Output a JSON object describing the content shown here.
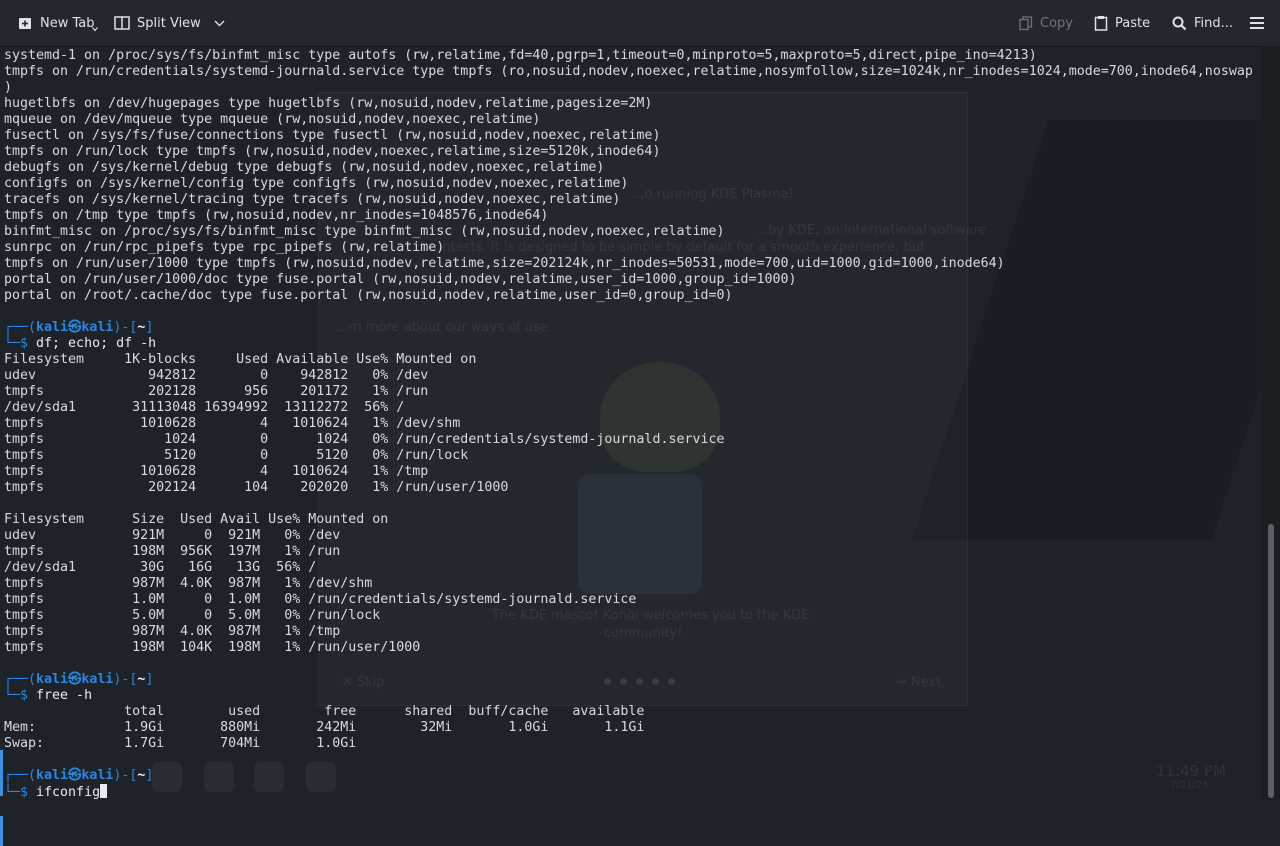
{
  "toolbar": {
    "new_tab": "New Tab",
    "split_view": "Split View",
    "copy": "Copy",
    "paste": "Paste",
    "find": "Find..."
  },
  "background_text": {
    "line1": "...o running KDE Plasma!",
    "line2": "...by KDE, an international software",
    "line3": "...ntests. It is designed to be simple by default for a smooth experience, but",
    "line4": "...rn more about our ways of use",
    "line5": "The KDE mascot Konqi welcomes you to the KDE",
    "line6": "community!",
    "skip": "✕ Skip",
    "next": "→ Next",
    "clock_time": "11:49 PM",
    "clock_date": "7/21/25"
  },
  "terminal": {
    "mount_lines": [
      "systemd-1 on /proc/sys/fs/binfmt_misc type autofs (rw,relatime,fd=40,pgrp=1,timeout=0,minproto=5,maxproto=5,direct,pipe_ino=4213)",
      "tmpfs on /run/credentials/systemd-journald.service type tmpfs (ro,nosuid,nodev,noexec,relatime,nosymfollow,size=1024k,nr_inodes=1024,mode=700,inode64,noswap",
      ")",
      "hugetlbfs on /dev/hugepages type hugetlbfs (rw,nosuid,nodev,relatime,pagesize=2M)",
      "mqueue on /dev/mqueue type mqueue (rw,nosuid,nodev,noexec,relatime)",
      "fusectl on /sys/fs/fuse/connections type fusectl (rw,nosuid,nodev,noexec,relatime)",
      "tmpfs on /run/lock type tmpfs (rw,nosuid,nodev,noexec,relatime,size=5120k,inode64)",
      "debugfs on /sys/kernel/debug type debugfs (rw,nosuid,nodev,noexec,relatime)",
      "configfs on /sys/kernel/config type configfs (rw,nosuid,nodev,noexec,relatime)",
      "tracefs on /sys/kernel/tracing type tracefs (rw,nosuid,nodev,noexec,relatime)",
      "tmpfs on /tmp type tmpfs (rw,nosuid,nodev,nr_inodes=1048576,inode64)",
      "binfmt_misc on /proc/sys/fs/binfmt_misc type binfmt_misc (rw,nosuid,nodev,noexec,relatime)",
      "sunrpc on /run/rpc_pipefs type rpc_pipefs (rw,relatime)",
      "tmpfs on /run/user/1000 type tmpfs (rw,nosuid,nodev,relatime,size=202124k,nr_inodes=50531,mode=700,uid=1000,gid=1000,inode64)",
      "portal on /run/user/1000/doc type fuse.portal (rw,nosuid,nodev,relatime,user_id=1000,group_id=1000)",
      "portal on /root/.cache/doc type fuse.portal (rw,nosuid,nodev,relatime,user_id=0,group_id=0)"
    ],
    "prompt_user": "kali",
    "prompt_at": "㉿",
    "prompt_host": "kali",
    "prompt_path": "~",
    "prompt_top_left": "┌──(",
    "prompt_mid": ")-[",
    "prompt_end": "]",
    "prompt_bottom": "└─$ ",
    "cmd1": "df; echo; df -h",
    "df_lines": [
      "Filesystem     1K-blocks     Used Available Use% Mounted on",
      "udev              942812        0    942812   0% /dev",
      "tmpfs             202128      956    201172   1% /run",
      "/dev/sda1       31113048 16394992  13112272  56% /",
      "tmpfs            1010628        4   1010624   1% /dev/shm",
      "tmpfs               1024        0      1024   0% /run/credentials/systemd-journald.service",
      "tmpfs               5120        0      5120   0% /run/lock",
      "tmpfs            1010628        4   1010624   1% /tmp",
      "tmpfs             202124      104    202020   1% /run/user/1000",
      "",
      "Filesystem      Size  Used Avail Use% Mounted on",
      "udev            921M     0  921M   0% /dev",
      "tmpfs           198M  956K  197M   1% /run",
      "/dev/sda1        30G   16G   13G  56% /",
      "tmpfs           987M  4.0K  987M   1% /dev/shm",
      "tmpfs           1.0M     0  1.0M   0% /run/credentials/systemd-journald.service",
      "tmpfs           5.0M     0  5.0M   0% /run/lock",
      "tmpfs           987M  4.0K  987M   1% /tmp",
      "tmpfs           198M  104K  198M   1% /run/user/1000"
    ],
    "cmd2": "free -h",
    "free_lines": [
      "               total        used        free      shared  buff/cache   available",
      "Mem:           1.9Gi       880Mi       242Mi        32Mi       1.0Gi       1.1Gi",
      "Swap:          1.7Gi       704Mi       1.0Gi"
    ],
    "cmd3": "ifconfig"
  }
}
